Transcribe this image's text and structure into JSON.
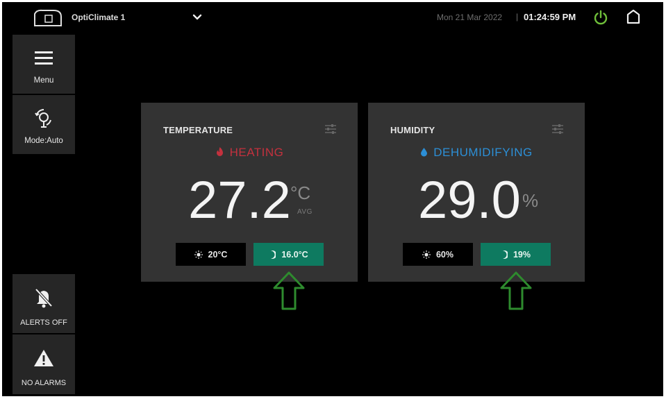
{
  "header": {
    "device_name": "OptiClimate 1",
    "date": "Mon 21 Mar 2022",
    "separator": "|",
    "time": "01:24:59 PM",
    "icons": [
      "device-logo-icon",
      "chevron-down-icon",
      "power-icon",
      "home-icon"
    ]
  },
  "sidebar": {
    "menu_label": "Menu",
    "mode_label": "Mode:Auto",
    "alerts_label": "ALERTS OFF",
    "alarms_label": "NO ALARMS"
  },
  "temperature": {
    "title": "TEMPERATURE",
    "status": "HEATING",
    "value": "27.2",
    "unit": "°C",
    "avg_label": "AVG",
    "day_setpoint": "20°C",
    "night_setpoint": "16.0°C"
  },
  "humidity": {
    "title": "HUMIDITY",
    "status": "DEHUMIDIFYING",
    "value": "29.0",
    "unit": "%",
    "day_setpoint": "60%",
    "night_setpoint": "19%"
  },
  "colors": {
    "heating": "#c4313e",
    "dehumidifying": "#2c8fd6",
    "night_button": "#0e7a60",
    "power": "#6fbf3a",
    "arrow": "#2e8b2e",
    "card": "#333333",
    "sidebar_button": "#262626"
  }
}
